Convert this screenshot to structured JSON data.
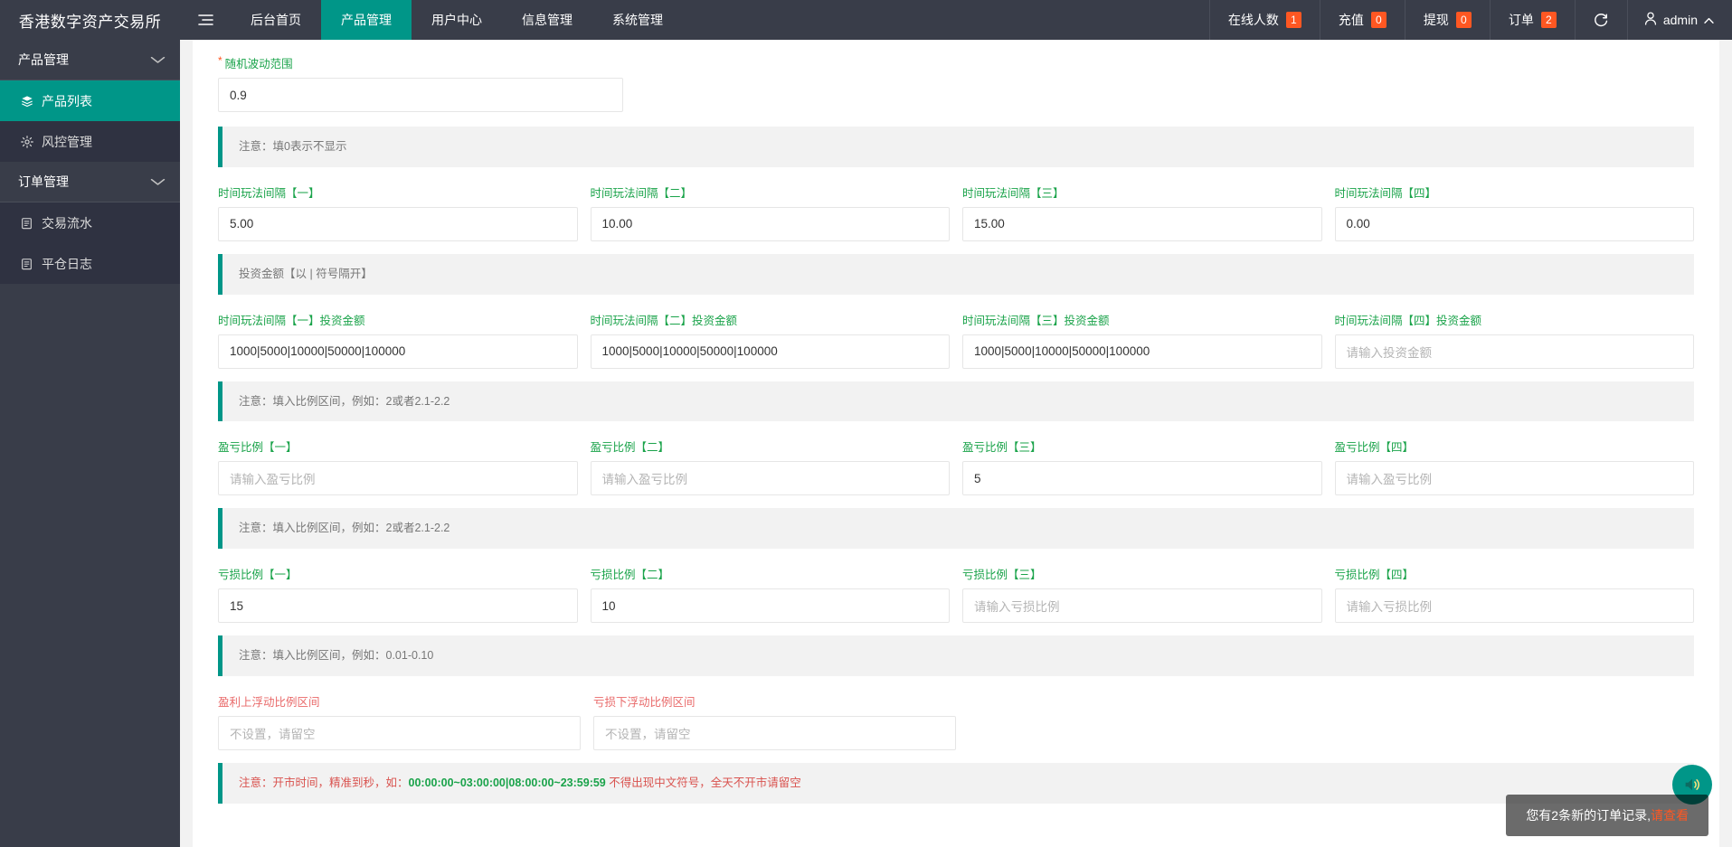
{
  "topbar": {
    "brand": "香港数字资产交易所",
    "hamburger_icon": "hamburger-icon",
    "nav_items": [
      {
        "label": "后台首页",
        "active": false
      },
      {
        "label": "产品管理",
        "active": true
      },
      {
        "label": "用户中心",
        "active": false
      },
      {
        "label": "信息管理",
        "active": false
      },
      {
        "label": "系统管理",
        "active": false
      }
    ],
    "stats": [
      {
        "label": "在线人数",
        "badge": "1"
      },
      {
        "label": "充值",
        "badge": "0"
      },
      {
        "label": "提现",
        "badge": "0"
      },
      {
        "label": "订单",
        "badge": "2"
      }
    ],
    "refresh_icon": "refresh-icon",
    "user": {
      "icon": "user-icon",
      "name": "admin",
      "caret": "chevron-up-icon"
    }
  },
  "sidebar": {
    "groups": [
      {
        "label": "产品管理",
        "caret": "chevron-down-icon",
        "items": [
          {
            "label": "产品列表",
            "icon": "layers-icon",
            "active": true
          },
          {
            "label": "风控管理",
            "icon": "gear-icon",
            "active": false
          }
        ]
      },
      {
        "label": "订单管理",
        "caret": "chevron-down-icon",
        "items": [
          {
            "label": "交易流水",
            "icon": "clipboard-icon",
            "active": false
          },
          {
            "label": "平仓日志",
            "icon": "clipboard-icon",
            "active": false
          }
        ]
      }
    ]
  },
  "form": {
    "random_range": {
      "label": "随机波动范围",
      "required": true,
      "value": "0.9"
    },
    "note_zero": "注意：填0表示不显示",
    "intervals": {
      "fields": [
        {
          "label": "时间玩法间隔【一】",
          "value": "5.00",
          "placeholder": ""
        },
        {
          "label": "时间玩法间隔【二】",
          "value": "10.00",
          "placeholder": ""
        },
        {
          "label": "时间玩法间隔【三】",
          "value": "15.00",
          "placeholder": ""
        },
        {
          "label": "时间玩法间隔【四】",
          "value": "0.00",
          "placeholder": ""
        }
      ]
    },
    "note_amount": "投资金额【以 | 符号隔开】",
    "amounts": {
      "fields": [
        {
          "label": "时间玩法间隔【一】投资金额",
          "value": "1000|5000|10000|50000|100000",
          "placeholder": "请输入投资金额"
        },
        {
          "label": "时间玩法间隔【二】投资金额",
          "value": "1000|5000|10000|50000|100000",
          "placeholder": "请输入投资金额"
        },
        {
          "label": "时间玩法间隔【三】投资金额",
          "value": "1000|5000|10000|50000|100000",
          "placeholder": "请输入投资金额"
        },
        {
          "label": "时间玩法间隔【四】投资金额",
          "value": "",
          "placeholder": "请输入投资金额"
        }
      ]
    },
    "note_ratio_1": "注意：填入比例区间，例如：2或者2.1-2.2",
    "profit_ratio": {
      "fields": [
        {
          "label": "盈亏比例【一】",
          "value": "",
          "placeholder": "请输入盈亏比例"
        },
        {
          "label": "盈亏比例【二】",
          "value": "",
          "placeholder": "请输入盈亏比例"
        },
        {
          "label": "盈亏比例【三】",
          "value": "5",
          "placeholder": "请输入盈亏比例"
        },
        {
          "label": "盈亏比例【四】",
          "value": "",
          "placeholder": "请输入盈亏比例"
        }
      ]
    },
    "note_ratio_2": "注意：填入比例区间，例如：2或者2.1-2.2",
    "loss_ratio": {
      "fields": [
        {
          "label": "亏损比例【一】",
          "value": "15",
          "placeholder": "请输入亏损比例"
        },
        {
          "label": "亏损比例【二】",
          "value": "10",
          "placeholder": "请输入亏损比例"
        },
        {
          "label": "亏损比例【三】",
          "value": "",
          "placeholder": "请输入亏损比例"
        },
        {
          "label": "亏损比例【四】",
          "value": "",
          "placeholder": "请输入亏损比例"
        }
      ]
    },
    "note_ratio_3": "注意：填入比例区间，例如：0.01-0.10",
    "float_ranges": {
      "fields": [
        {
          "label": "盈利上浮动比例区间",
          "value": "",
          "placeholder": "不设置，请留空"
        },
        {
          "label": "亏损下浮动比例区间",
          "value": "",
          "placeholder": "不设置，请留空"
        }
      ]
    },
    "note_market_time": {
      "prefix": "注意：开市时间，精准到秒，如：",
      "highlight": "00:00:00~03:00:00|08:00:00~23:59:59",
      "suffix": " 不得出现中文符号，全天不开市请留空"
    }
  },
  "toast": {
    "message": "您有2条新的订单记录,",
    "link": "请查看",
    "sound_icon": "speaker-icon"
  },
  "colors": {
    "brand_green": "#009688",
    "label_green": "#1AA34A",
    "label_red": "#e96a6a",
    "badge_orange": "#FF5722",
    "dark_nav": "#393D49",
    "dark_sub": "#2F3241"
  }
}
